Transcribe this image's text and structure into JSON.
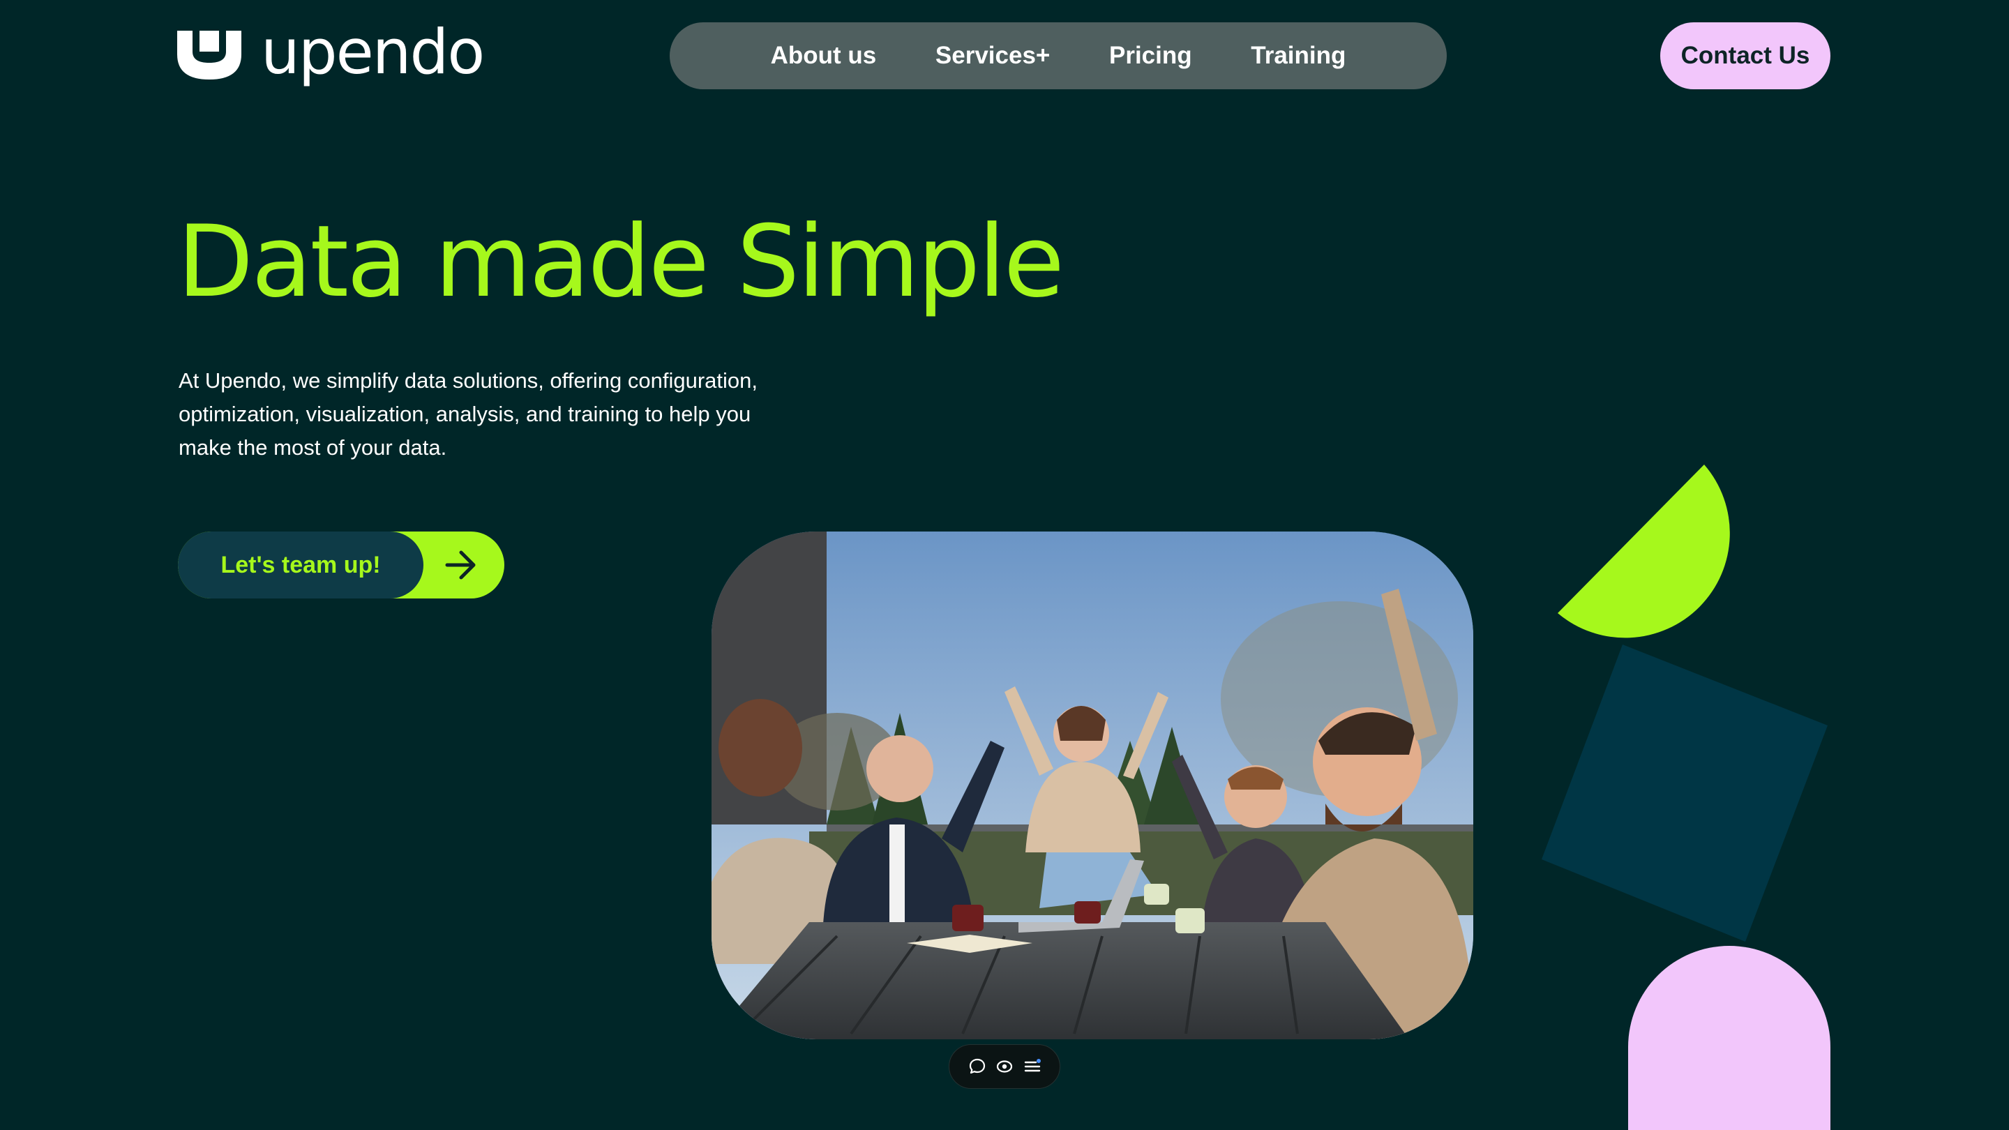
{
  "brand": {
    "name": "upendo"
  },
  "nav": {
    "items": [
      {
        "label": "About us"
      },
      {
        "label": "Services+"
      },
      {
        "label": "Pricing"
      },
      {
        "label": "Training"
      }
    ]
  },
  "header": {
    "contact_label": "Contact Us"
  },
  "hero": {
    "title": "Data made Simple",
    "description": "At Upendo, we simplify data solutions, offering configuration, optimization, visualization, analysis, and training to help you make the most of your data.",
    "cta_label": "Let's team up!",
    "cta_icon": "arrow-right-icon"
  },
  "toolbar": {
    "icons": [
      "comment-icon",
      "eye-icon",
      "list-icon"
    ]
  },
  "colors": {
    "background": "#002628",
    "accent_lime": "#a6f81c",
    "accent_pink": "#f2c6fb",
    "nav_pill": "#4f5f5f",
    "teal_dark": "#0e3b47"
  }
}
